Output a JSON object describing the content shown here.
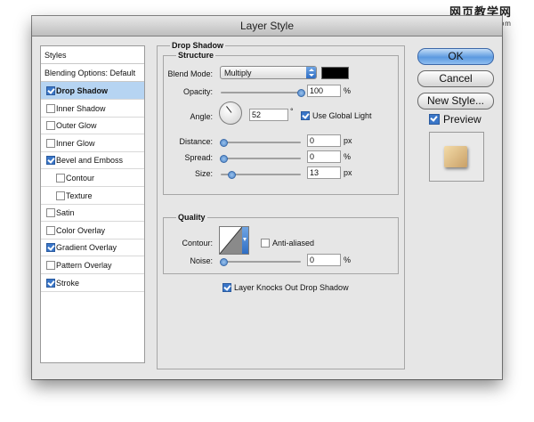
{
  "watermark": {
    "line1": "网页教学网",
    "line2": "www.webjx.com"
  },
  "window": {
    "title": "Layer Style"
  },
  "styles_panel": {
    "header": "Styles",
    "blending_options": "Blending Options: Default",
    "items": [
      {
        "label": "Drop Shadow",
        "checked": true,
        "selected": true,
        "sub": false
      },
      {
        "label": "Inner Shadow",
        "checked": false,
        "selected": false,
        "sub": false
      },
      {
        "label": "Outer Glow",
        "checked": false,
        "selected": false,
        "sub": false
      },
      {
        "label": "Inner Glow",
        "checked": false,
        "selected": false,
        "sub": false
      },
      {
        "label": "Bevel and Emboss",
        "checked": true,
        "selected": false,
        "sub": false
      },
      {
        "label": "Contour",
        "checked": false,
        "selected": false,
        "sub": true
      },
      {
        "label": "Texture",
        "checked": false,
        "selected": false,
        "sub": true
      },
      {
        "label": "Satin",
        "checked": false,
        "selected": false,
        "sub": false
      },
      {
        "label": "Color Overlay",
        "checked": false,
        "selected": false,
        "sub": false
      },
      {
        "label": "Gradient Overlay",
        "checked": true,
        "selected": false,
        "sub": false
      },
      {
        "label": "Pattern Overlay",
        "checked": false,
        "selected": false,
        "sub": false
      },
      {
        "label": "Stroke",
        "checked": true,
        "selected": false,
        "sub": false
      }
    ]
  },
  "drop_shadow": {
    "section_title": "Drop Shadow",
    "structure": {
      "title": "Structure",
      "blend_mode_label": "Blend Mode:",
      "blend_mode_value": "Multiply",
      "shadow_color": "#000000",
      "opacity_label": "Opacity:",
      "opacity_value": "100",
      "opacity_unit": "%",
      "angle_label": "Angle:",
      "angle_value": "52",
      "angle_unit": "°",
      "use_global_light_label": "Use Global Light",
      "distance_label": "Distance:",
      "distance_value": "0",
      "distance_unit": "px",
      "spread_label": "Spread:",
      "spread_value": "0",
      "spread_unit": "%",
      "size_label": "Size:",
      "size_value": "13",
      "size_unit": "px"
    },
    "quality": {
      "title": "Quality",
      "contour_label": "Contour:",
      "anti_aliased_label": "Anti-aliased",
      "noise_label": "Noise:",
      "noise_value": "0",
      "noise_unit": "%"
    },
    "knockout_label": "Layer Knocks Out Drop Shadow"
  },
  "buttons": {
    "ok": "OK",
    "cancel": "Cancel",
    "new_style": "New Style..."
  },
  "preview": {
    "label": "Preview"
  },
  "colors": {
    "selection": "#b6d4f2",
    "accent": "#3a76c8",
    "dialog_bg": "#e6e6e6"
  }
}
